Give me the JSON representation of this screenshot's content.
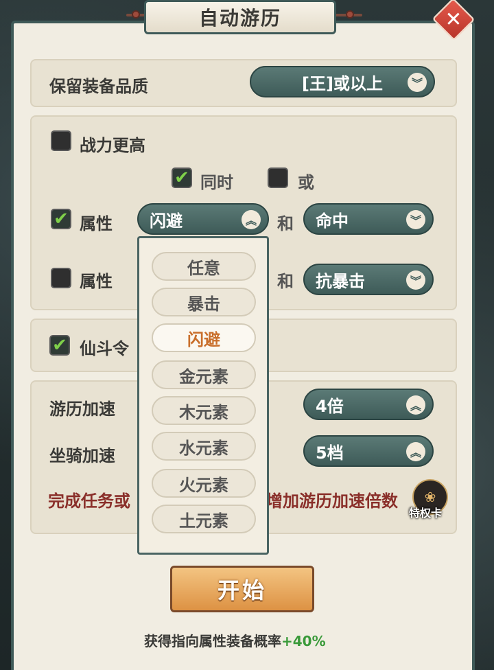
{
  "title": "自动游历",
  "close_icon": "close-x-icon",
  "quality": {
    "label": "保留装备品质",
    "value": "[王]或以上"
  },
  "power": {
    "label": "战力更高",
    "checked": false
  },
  "logic": {
    "same": "同时",
    "same_checked": true,
    "or": "或",
    "or_checked": false
  },
  "attr1": {
    "label": "属性",
    "checked": true,
    "value": "闪避",
    "and": "和",
    "value2": "命中"
  },
  "attr2": {
    "label": "属性",
    "checked": false,
    "and": "和",
    "value2": "抗暴击"
  },
  "token": {
    "label": "仙斗令",
    "checked": true
  },
  "speed": {
    "label": "游历加速",
    "value": "4倍"
  },
  "mount": {
    "label": "坐骑加速",
    "value": "5档"
  },
  "notice": {
    "left": "完成任务或",
    "right": "增加游历加速倍数"
  },
  "badge": {
    "label": "特权卡"
  },
  "dropdown": {
    "options": [
      "任意",
      "暴击",
      "闪避",
      "金元素",
      "木元素",
      "水元素",
      "火元素",
      "土元素"
    ],
    "selected": "闪避"
  },
  "start": {
    "label": "开始"
  },
  "bonus": {
    "text": "获得指向属性装备概率",
    "value": "+40%"
  }
}
